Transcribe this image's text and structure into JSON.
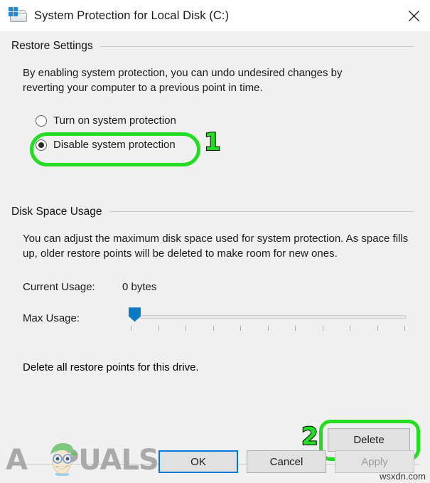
{
  "window": {
    "title": "System Protection for Local Disk (C:)",
    "icon": "drive-windows-icon",
    "close_label": "✕"
  },
  "restore_settings": {
    "group_label": "Restore Settings",
    "description": "By enabling system protection, you can undo undesired changes by reverting your computer to a previous point in time.",
    "options": [
      {
        "label": "Turn on system protection",
        "checked": false
      },
      {
        "label": "Disable system protection",
        "checked": true
      }
    ],
    "annotation": "1"
  },
  "disk_space_usage": {
    "group_label": "Disk Space Usage",
    "description": "You can adjust the maximum disk space used for system protection. As space fills up, older restore points will be deleted to make room for new ones.",
    "current_usage_label": "Current Usage:",
    "current_usage_value": "0 bytes",
    "max_usage_label": "Max Usage:",
    "slider": {
      "value_percent": 0,
      "tick_count": 11
    }
  },
  "delete_section": {
    "description": "Delete all restore points for this drive.",
    "button_label": "Delete",
    "annotation": "2"
  },
  "footer": {
    "ok_label": "OK",
    "cancel_label": "Cancel",
    "apply_label": "Apply",
    "apply_disabled": true
  },
  "watermark": {
    "brand_prefix": "A",
    "brand_suffix": "PUALS",
    "site_credit": "wsxdn.com"
  },
  "colors": {
    "highlight_green": "#22dd22",
    "accent_blue": "#0078d7",
    "slider_blue": "#0a7ac4",
    "dialog_bg": "#f0f0f0",
    "titlebar_bg": "#ffffff"
  }
}
